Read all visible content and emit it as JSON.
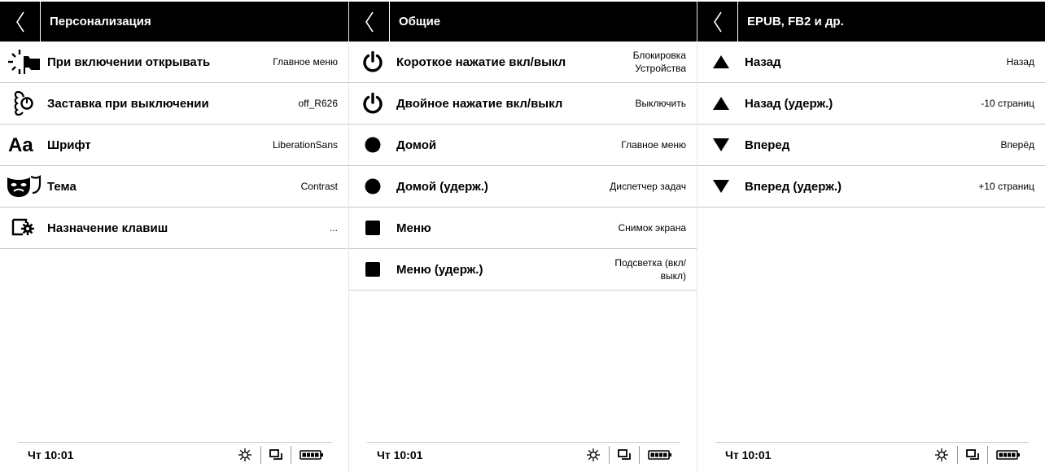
{
  "screens": [
    {
      "title": "Персонализация",
      "rows": [
        {
          "icon": "startup-flag-icon",
          "label": "При включении открывать",
          "value": "Главное меню"
        },
        {
          "icon": "screensaver-icon",
          "label": "Заставка при выключении",
          "value": "off_R626"
        },
        {
          "icon": "font-icon",
          "label": "Шрифт",
          "value": "LiberationSans"
        },
        {
          "icon": "theme-masks-icon",
          "label": "Тема",
          "value": "Contrast"
        },
        {
          "icon": "key-mapping-icon",
          "label": "Назначение клавиш",
          "value": "..."
        }
      ],
      "status": {
        "time": "Чт 10:01"
      }
    },
    {
      "title": "Общие",
      "rows": [
        {
          "icon": "power-icon",
          "label": "Короткое нажатие вкл/выкл",
          "value": "Блокировка Устройства"
        },
        {
          "icon": "power-icon",
          "label": "Двойное нажатие вкл/выкл",
          "value": "Выключить"
        },
        {
          "icon": "circle-icon",
          "label": "Домой",
          "value": "Главное меню"
        },
        {
          "icon": "circle-icon",
          "label": "Домой (удерж.)",
          "value": "Диспетчер задач"
        },
        {
          "icon": "square-icon",
          "label": "Меню",
          "value": "Снимок экрана"
        },
        {
          "icon": "square-icon",
          "label": "Меню (удерж.)",
          "value": "Подсветка (вкл/ выкл)"
        }
      ],
      "status": {
        "time": "Чт 10:01"
      }
    },
    {
      "title": "EPUB, FB2 и др.",
      "rows": [
        {
          "icon": "triangle-up-icon",
          "label": "Назад",
          "value": "Назад"
        },
        {
          "icon": "triangle-up-icon",
          "label": "Назад (удерж.)",
          "value": "-10 страниц"
        },
        {
          "icon": "triangle-down-icon",
          "label": "Вперед",
          "value": "Вперёд"
        },
        {
          "icon": "triangle-down-icon",
          "label": "Вперед (удерж.)",
          "value": "+10 страниц"
        }
      ],
      "status": {
        "time": "Чт 10:01"
      }
    }
  ],
  "status_icons": [
    "brightness-icon",
    "windows-icon",
    "battery-icon"
  ],
  "colors": {
    "header_bg": "#000000",
    "header_text": "#ffffff",
    "divider": "#c8c8c8"
  }
}
